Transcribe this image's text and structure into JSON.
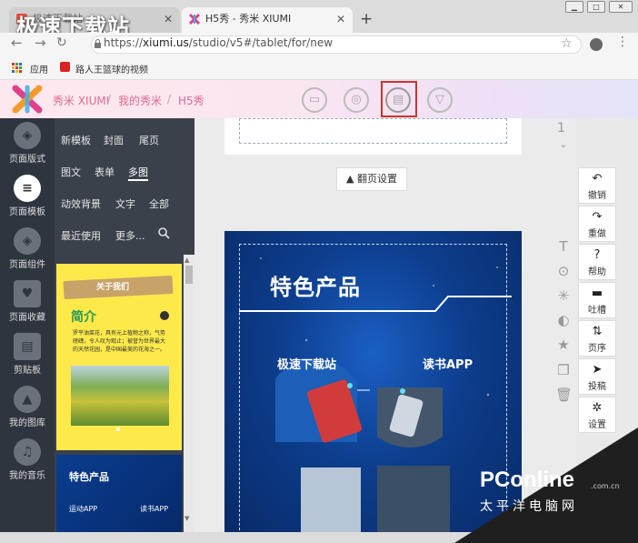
{
  "watermark": "极速下载站",
  "tabs": [
    {
      "label": "极速下载站"
    },
    {
      "label": "H5秀 - 秀米 XIUMI"
    }
  ],
  "new_tab_icon": "+",
  "address": {
    "protocol": "https://",
    "host": "xiumi.us",
    "path": "/studio/v5#/tablet/for/new"
  },
  "bookmarks": {
    "apps_label": "应用",
    "item": "路人王篮球的视频"
  },
  "header": {
    "crumbs": [
      "秀米 XIUMI",
      "我的秀米",
      "H5秀"
    ],
    "tools": [
      "folder-icon",
      "preview-icon",
      "save-icon",
      "dropdown-icon"
    ]
  },
  "sidebar": [
    {
      "label": "页面版式",
      "icon": "layout-icon"
    },
    {
      "label": "页面模板",
      "icon": "template-icon"
    },
    {
      "label": "页面组件",
      "icon": "component-icon"
    },
    {
      "label": "页面收藏",
      "icon": "favorite-icon"
    },
    {
      "label": "剪贴板",
      "icon": "clipboard-icon"
    },
    {
      "label": "我的图库",
      "icon": "gallery-icon"
    },
    {
      "label": "我的音乐",
      "icon": "music-icon"
    }
  ],
  "template_filters": [
    "新模板",
    "封面",
    "尾页",
    "图文",
    "表单",
    "多图",
    "动效背景",
    "文字",
    "全部",
    "最近使用",
    "更多..."
  ],
  "thumbnails": {
    "t1_banner": "关于我们",
    "t1_title": "简介",
    "t1_body": "罗平油菜花，具有元上植物之称，气势磅礴，令人叹为观止；被誉为世界最大的天然花园，是中国最美的花海之一。",
    "t2_title": "特色产品",
    "t2_left": "运动APP",
    "t2_right": "读书APP"
  },
  "canvas": {
    "page_number": "1",
    "page_settings_label": "翻页设置",
    "card_title": "特色产品",
    "left_label": "极速下载站",
    "right_label": "读书APP"
  },
  "right_tools": [
    {
      "label": "撤销",
      "glyph": "↶"
    },
    {
      "label": "重做",
      "glyph": "↷"
    },
    {
      "label": "帮助",
      "glyph": "?"
    },
    {
      "label": "吐槽",
      "glyph": "▬"
    },
    {
      "label": "页序",
      "glyph": "⇅"
    },
    {
      "label": "投稿",
      "glyph": "➤"
    },
    {
      "label": "设置",
      "glyph": "✲"
    }
  ],
  "brand": {
    "name": "PConline",
    "suffix": ".com.cn",
    "cn": "太平洋电脑网"
  },
  "colors": {
    "accent": "#c9352d",
    "sidebar": "#2f353f",
    "card": "#0d3d8c"
  }
}
